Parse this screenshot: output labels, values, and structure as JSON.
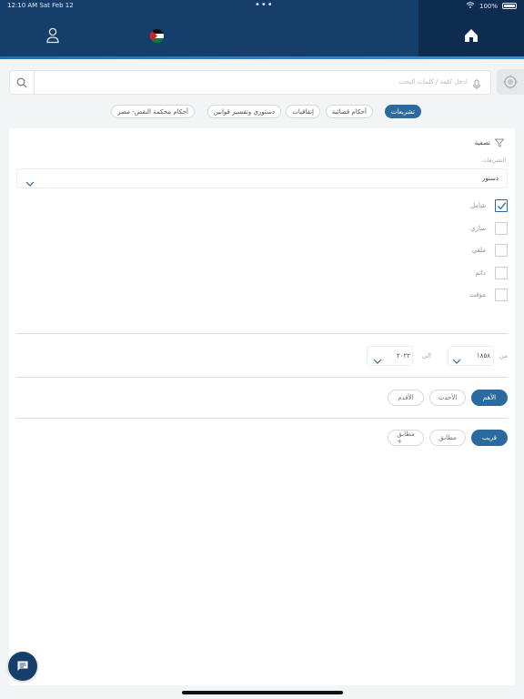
{
  "status_bar": {
    "time_date": "12:10 AM   Sat Feb 12",
    "more": "•••",
    "battery": "100%"
  },
  "search": {
    "placeholder": "ادخل كلمة / كلمات البحث",
    "value": ""
  },
  "categories": [
    {
      "label": "تشريعات",
      "active": true
    },
    {
      "label": "أحكام قضائية",
      "active": false
    },
    {
      "label": "إتفاقيات",
      "active": false
    },
    {
      "label": "دستوري وتفسير قوانين",
      "active": false
    },
    {
      "label": "أحكام محكمة النقض- مصر",
      "active": false
    }
  ],
  "filter": {
    "title": "تصفية",
    "legislation_label": "التشريعات",
    "legislation_value": "دستور",
    "status_options": [
      {
        "label": "شامل",
        "checked": true
      },
      {
        "label": "ساري",
        "checked": false
      },
      {
        "label": "ملغي",
        "checked": false
      },
      {
        "label": "دائم",
        "checked": false
      },
      {
        "label": "مؤقت",
        "checked": false
      }
    ],
    "range": {
      "from_label": "من",
      "from_value": "١٨٥٨",
      "to_label": "الى",
      "to_value": "٢٠٢٢"
    },
    "sort": [
      {
        "label": "الأهم",
        "active": true
      },
      {
        "label": "الأحدث",
        "active": false
      },
      {
        "label": "الأقدم",
        "active": false
      }
    ],
    "match": [
      {
        "label": "قريب",
        "active": true
      },
      {
        "label": "مطابق",
        "active": false
      },
      {
        "label": "مطابق +",
        "active": false
      }
    ]
  },
  "colors": {
    "brand": "#163e6b",
    "accent": "#2a6a9f"
  },
  "icons": [
    "home-icon",
    "user-icon",
    "jordan-flag-icon",
    "search-icon",
    "mic-icon",
    "target-icon",
    "filter-icon",
    "chevron-down-icon",
    "check-icon",
    "chat-icon"
  ]
}
